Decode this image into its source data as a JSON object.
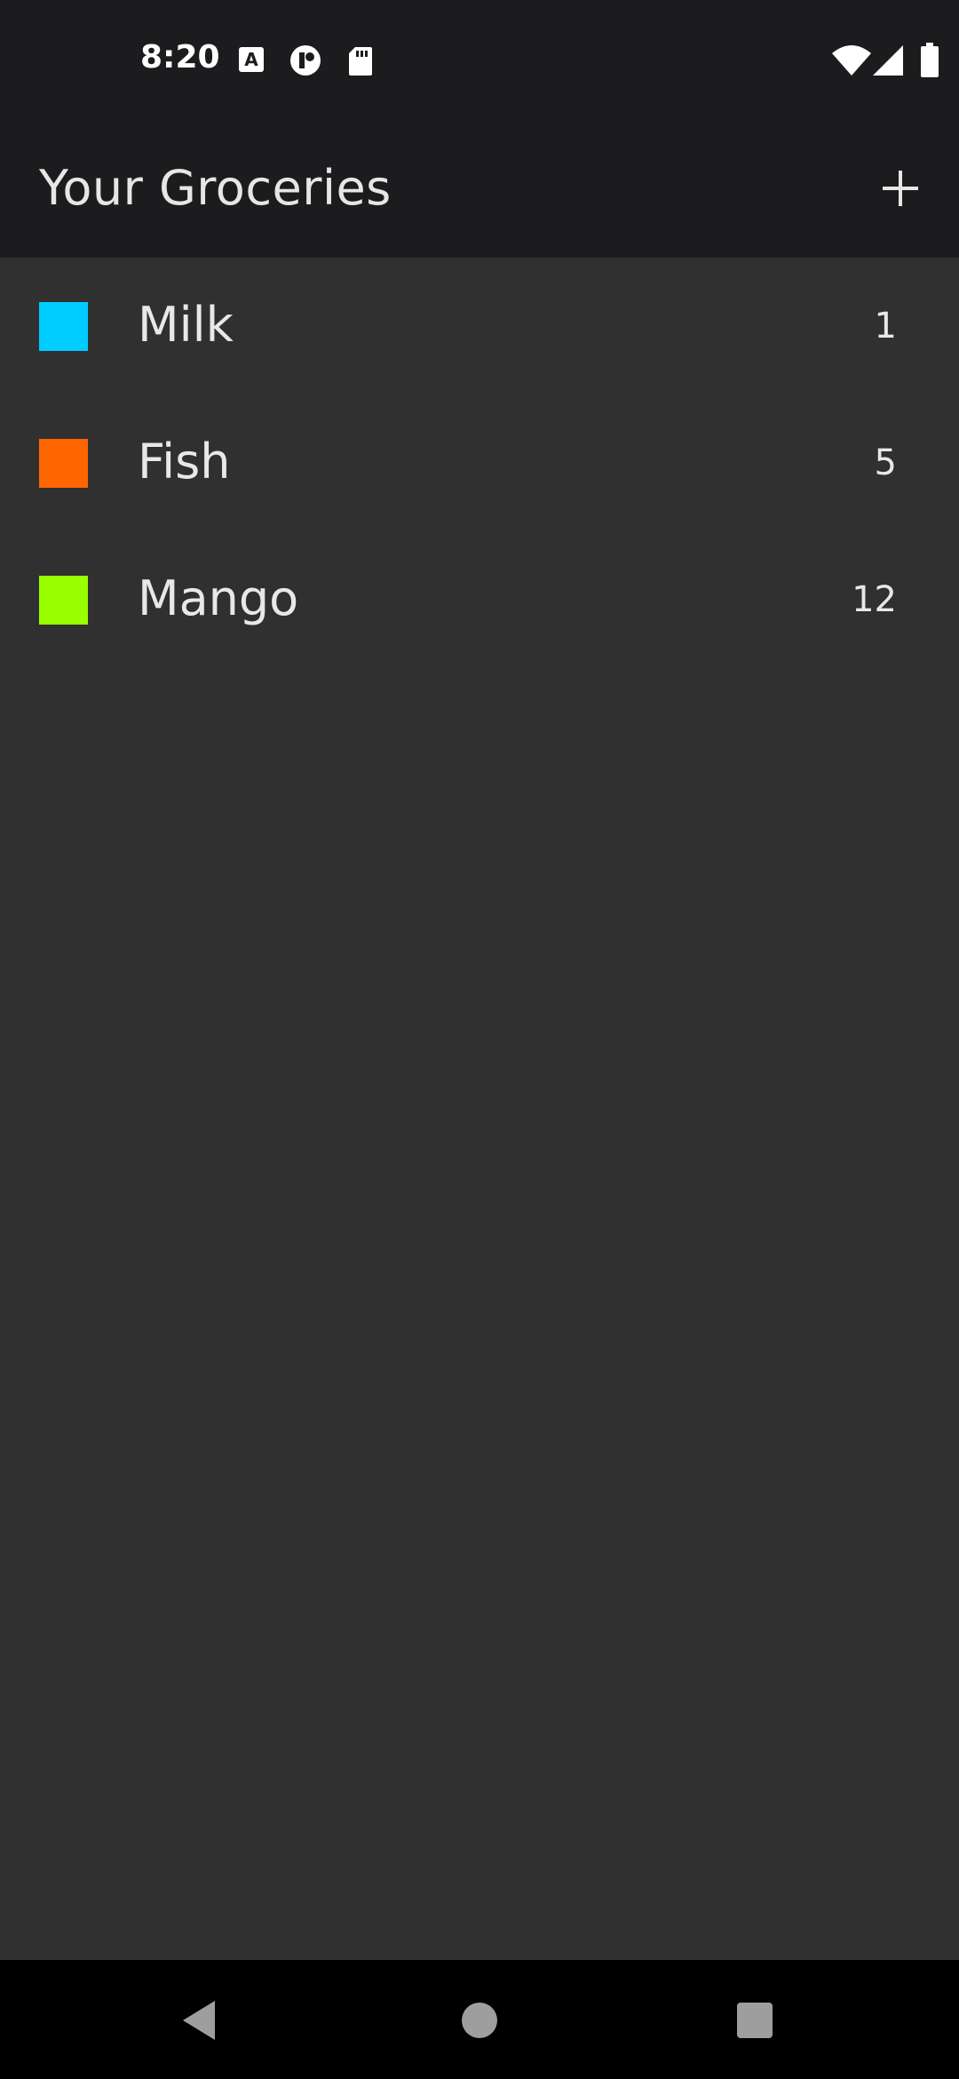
{
  "status_bar": {
    "time": "8:20",
    "icons": [
      "text-a-icon",
      "record-icon",
      "sd-card-icon",
      "wifi-icon",
      "signal-icon",
      "battery-icon"
    ]
  },
  "app_bar": {
    "title": "Your Groceries",
    "add_icon": "plus-icon"
  },
  "groceries": [
    {
      "name": "Milk",
      "quantity": "1",
      "color": "#00ccff"
    },
    {
      "name": "Fish",
      "quantity": "5",
      "color": "#ff6600"
    },
    {
      "name": "Mango",
      "quantity": "12",
      "color": "#99ff00"
    }
  ],
  "nav_bar": {
    "back_icon": "back-triangle-icon",
    "home_icon": "home-circle-icon",
    "recents_icon": "recents-square-icon"
  },
  "colors": {
    "app_bar_bg": "#1c1c1e",
    "background": "#303030",
    "text": "#e8e8e8"
  }
}
